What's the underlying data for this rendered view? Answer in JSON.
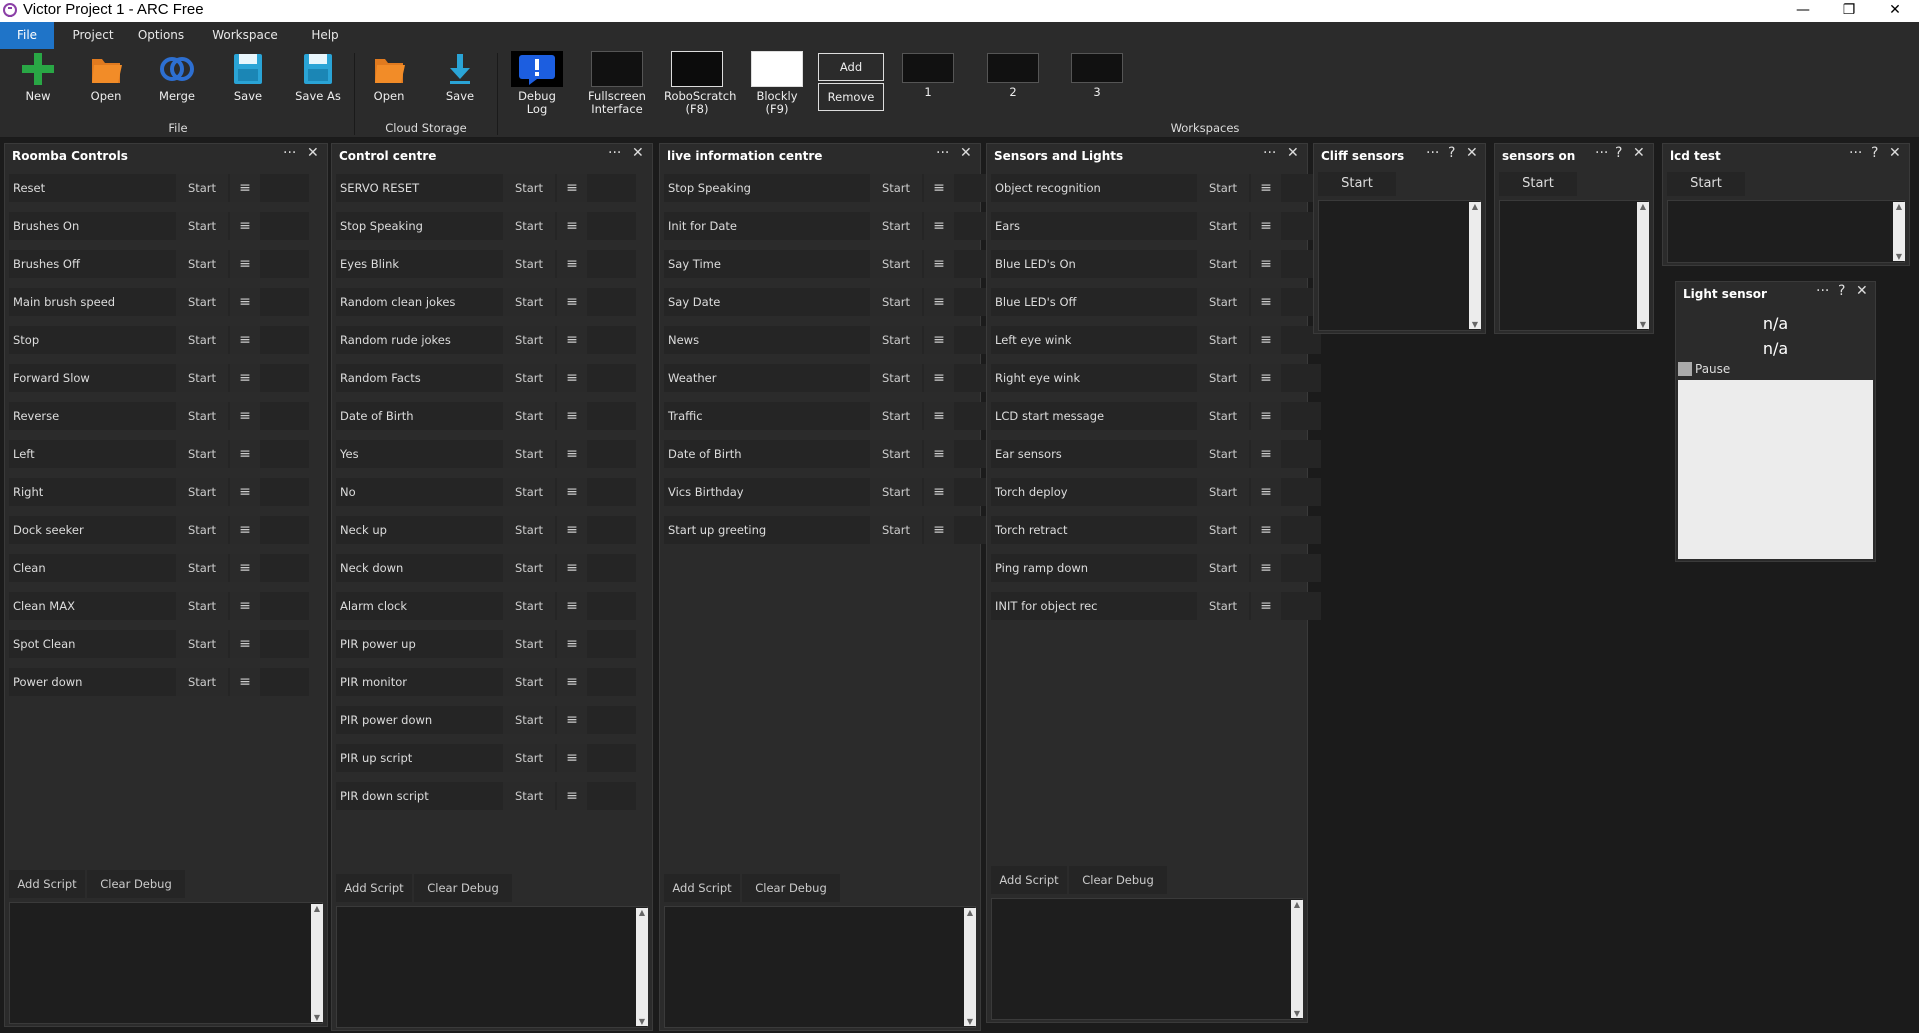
{
  "window": {
    "title": "Victor Project 1 - ARC Free",
    "minimize": "—",
    "maximize": "❐",
    "close": "✕"
  },
  "menu": [
    "File",
    "Project",
    "Options",
    "Workspace",
    "Help"
  ],
  "ribbon": {
    "file_group": {
      "label": "File",
      "buttons": [
        "New",
        "Open",
        "Merge",
        "Save",
        "Save As"
      ]
    },
    "cloud_group": {
      "label": "Cloud Storage",
      "buttons": [
        "Open",
        "Save"
      ]
    },
    "tools": {
      "debug_log": "Debug Log",
      "fullscreen_1": "Fullscreen",
      "fullscreen_2": "Interface",
      "roboscratch_1": "RoboScratch",
      "roboscratch_2": "(F8)",
      "blockly_1": "Blockly",
      "blockly_2": "(F9)"
    },
    "workspaces": {
      "label": "Workspaces",
      "add": "Add",
      "remove": "Remove",
      "items": [
        "1",
        "2",
        "3"
      ]
    }
  },
  "common": {
    "start": "Start",
    "menu_glyph": "≡",
    "more": "···",
    "help": "?",
    "close": "✕",
    "add_script": "Add Script",
    "clear_debug": "Clear Debug"
  },
  "panels": {
    "roomba": {
      "title": "Roomba Controls",
      "scripts": [
        "Reset",
        "Brushes On",
        "Brushes Off",
        "Main brush speed",
        "Stop",
        "Forward Slow",
        "Reverse",
        "Left",
        "Right",
        "Dock seeker",
        "Clean",
        "Clean MAX",
        "Spot Clean",
        "Power down"
      ]
    },
    "control": {
      "title": "Control centre",
      "scripts": [
        "SERVO RESET",
        "Stop Speaking",
        "Eyes Blink",
        "Random clean jokes",
        "Random rude jokes",
        "Random Facts",
        "Date of Birth",
        "Yes",
        "No",
        "Neck up",
        "Neck down",
        "Alarm clock",
        "PIR power up",
        "PIR monitor",
        "PIR power down",
        "PIR up script",
        "PIR down script"
      ]
    },
    "live": {
      "title": "live information centre",
      "scripts": [
        "Stop Speaking",
        "Init for Date",
        "Say Time",
        "Say Date",
        "News",
        "Weather",
        "Traffic",
        "Date of Birth",
        "Vics Birthday",
        "Start up greeting"
      ]
    },
    "sensors": {
      "title": "Sensors and Lights",
      "scripts": [
        "Object recognition",
        "Ears",
        "Blue LED's On",
        "Blue LED's Off",
        "Left eye wink",
        "Right eye wink",
        "LCD start message",
        "Ear sensors",
        "Torch deploy",
        "Torch retract",
        "Ping ramp down",
        "INIT for object rec"
      ]
    },
    "cliff": {
      "title": "Cliff sensors"
    },
    "sensors_on": {
      "title": "sensors on"
    },
    "lcd": {
      "title": "lcd test"
    },
    "light": {
      "title": "Light sensor",
      "value1": "n/a",
      "value2": "n/a",
      "pause": "Pause"
    }
  }
}
